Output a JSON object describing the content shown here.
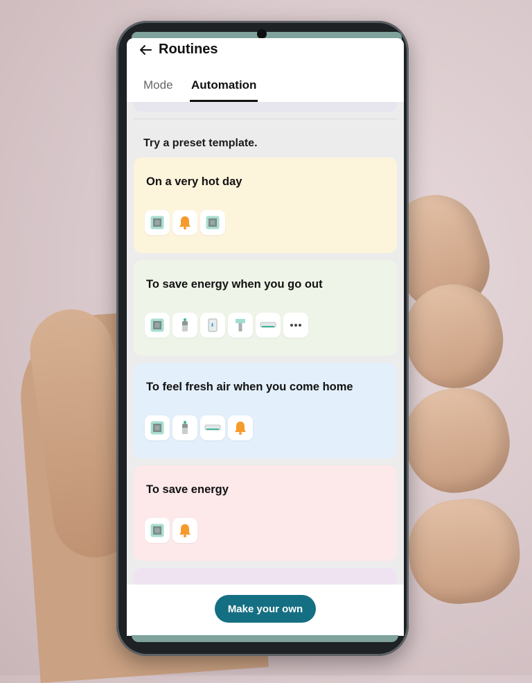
{
  "header": {
    "title": "Routines",
    "tabs": [
      {
        "label": "Mode"
      },
      {
        "label": "Automation"
      }
    ]
  },
  "section_title": "Try a preset template.",
  "cards": [
    {
      "title": "On a very hot day",
      "bg": "#fdf4dc",
      "icons": [
        "aircon-cassette-icon",
        "bell-icon",
        "aircon-cassette-icon"
      ]
    },
    {
      "title": "To save energy when you go out",
      "bg": "#eef5e8",
      "icons": [
        "aircon-cassette-icon",
        "air-purifier-icon",
        "refrigerator-icon",
        "dehumidifier-icon",
        "wall-aircon-icon",
        "more-icon"
      ]
    },
    {
      "title": "To feel fresh air when you come home",
      "bg": "#e3effa",
      "icons": [
        "aircon-cassette-icon",
        "air-purifier-icon",
        "wall-aircon-icon",
        "bell-icon"
      ]
    },
    {
      "title": "To save energy",
      "bg": "#fde8ea",
      "icons": [
        "aircon-cassette-icon",
        "bell-icon"
      ]
    }
  ],
  "next_card_bg": "#efe3f2",
  "footer": {
    "button_label": "Make your own",
    "button_color": "#156f82"
  }
}
